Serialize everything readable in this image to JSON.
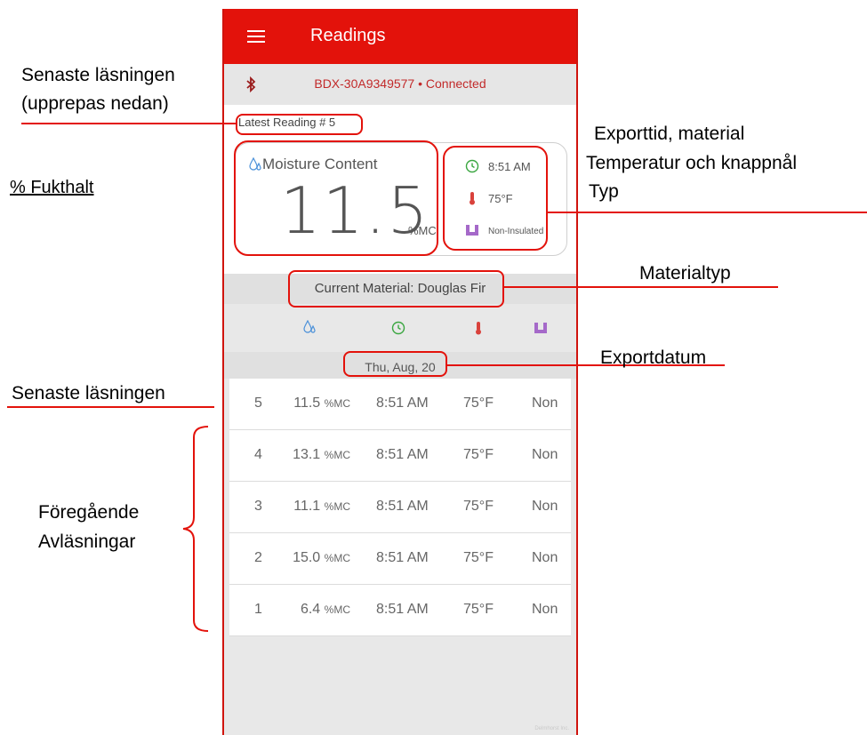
{
  "app": {
    "title": "Readings",
    "connection": "BDX-30A9349577 • Connected",
    "latest_label": "Latest Reading # 5",
    "moisture_title": "Moisture Content",
    "moisture_value": "11.5",
    "moisture_unit": "%MC",
    "time": "8:51 AM",
    "temperature": "75°F",
    "pin_type": "Non-Insulated",
    "current_material": "Current Material: Douglas Fir",
    "date": "Thu, Aug, 20",
    "footer_note": "Delmhorst Inc."
  },
  "readings": [
    {
      "num": "5",
      "value": "11.5",
      "unit": "%MC",
      "time": "8:51 AM",
      "temp": "75°F",
      "type": "Non"
    },
    {
      "num": "4",
      "value": "13.1",
      "unit": "%MC",
      "time": "8:51 AM",
      "temp": "75°F",
      "type": "Non"
    },
    {
      "num": "3",
      "value": "11.1",
      "unit": "%MC",
      "time": "8:51 AM",
      "temp": "75°F",
      "type": "Non"
    },
    {
      "num": "2",
      "value": "15.0",
      "unit": "%MC",
      "time": "8:51 AM",
      "temp": "75°F",
      "type": "Non"
    },
    {
      "num": "1",
      "value": "6.4",
      "unit": "%MC",
      "time": "8:51 AM",
      "temp": "75°F",
      "type": "Non"
    }
  ],
  "annotations": {
    "latest_line1": "Senaste läsningen",
    "latest_line2": "(upprepas nedan)",
    "fukthalt": "% Fukthalt",
    "export_line1": "Exporttid, material",
    "export_line2": "Temperatur och knappnål",
    "export_line3": "Typ",
    "materialtyp": "Materialtyp",
    "exportdatum": "Exportdatum",
    "senaste": "Senaste läsningen",
    "foregaende_line1": "Föregående",
    "foregaende_line2": "Avläsningar"
  },
  "colors": {
    "appbar": "#e3120b",
    "annotation_red": "#e3120b",
    "clock_green": "#3aa640",
    "thermo_red": "#d9423c",
    "pin_purple": "#a569c9",
    "drop_blue": "#4a90d9"
  },
  "icons": [
    "menu-icon",
    "bluetooth-icon",
    "moisture-drop-icon",
    "clock-icon",
    "thermometer-icon",
    "pin-icon"
  ]
}
